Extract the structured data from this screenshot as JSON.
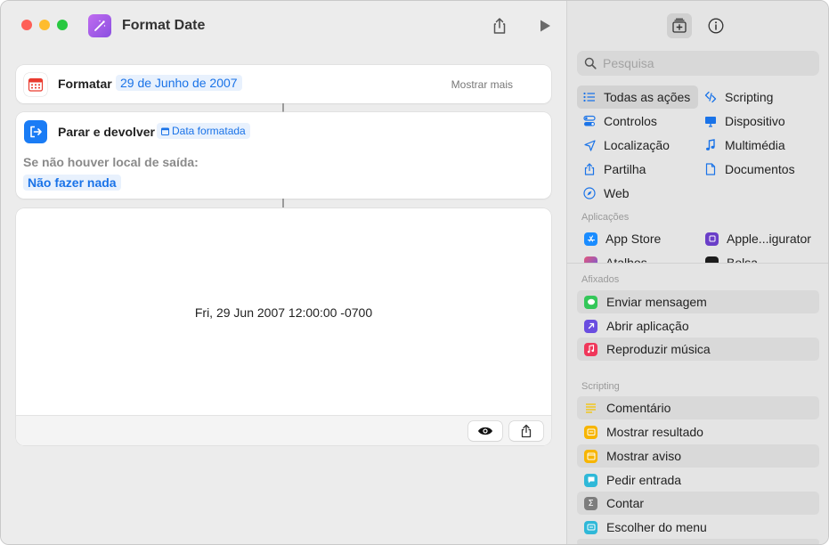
{
  "window": {
    "title": "Format Date"
  },
  "actions": {
    "format": {
      "label": "Formatar",
      "value": "29 de Junho de 2007",
      "more": "Mostrar mais"
    },
    "stop": {
      "label": "Parar e devolver",
      "token": "Data formatada",
      "fallback_label": "Se não houver local de saída:",
      "fallback_value": "Não fazer nada"
    }
  },
  "result": {
    "text": "Fri, 29 Jun 2007 12:00:00 -0700"
  },
  "sidebar": {
    "search_placeholder": "Pesquisa",
    "categories": [
      {
        "label": "Todas as ações",
        "icon": "list-icon"
      },
      {
        "label": "Scripting",
        "icon": "scripting-icon"
      },
      {
        "label": "Controlos",
        "icon": "toggle-icon"
      },
      {
        "label": "Dispositivo",
        "icon": "display-icon"
      },
      {
        "label": "Localização",
        "icon": "location-arrow-icon"
      },
      {
        "label": "Multimédia",
        "icon": "music-note-icon"
      },
      {
        "label": "Partilha",
        "icon": "share-icon"
      },
      {
        "label": "Documentos",
        "icon": "document-icon"
      },
      {
        "label": "Web",
        "icon": "compass-icon"
      }
    ],
    "apps_header": "Aplicações",
    "apps": [
      {
        "label": "App Store",
        "icon": "app-store-icon",
        "color": "#1a8cff"
      },
      {
        "label": "Apple...igurator",
        "icon": "apple-configurator-icon",
        "color": "#6a3ec8"
      },
      {
        "label": "Atalhos",
        "icon": "shortcuts-icon",
        "color": "#d9486b"
      },
      {
        "label": "Bolsa",
        "icon": "stocks-icon",
        "color": "#1c1c1c"
      }
    ],
    "pinned_header": "Afixados",
    "pinned": [
      {
        "label": "Enviar mensagem",
        "icon": "messages-icon",
        "color": "#34c759"
      },
      {
        "label": "Abrir aplicação",
        "icon": "open-app-icon",
        "color": "#6a4de0"
      },
      {
        "label": "Reproduzir música",
        "icon": "music-icon",
        "color": "#f0375a"
      }
    ],
    "scripting_header": "Scripting",
    "scripting": [
      {
        "label": "Comentário",
        "icon": "comment-icon",
        "color": "#f5d33a"
      },
      {
        "label": "Mostrar resultado",
        "icon": "show-result-icon",
        "color": "#f7b500"
      },
      {
        "label": "Mostrar aviso",
        "icon": "alert-icon",
        "color": "#f7b500"
      },
      {
        "label": "Pedir entrada",
        "icon": "ask-input-icon",
        "color": "#2fb8d8"
      },
      {
        "label": "Contar",
        "icon": "sigma-icon",
        "color": "#7d7d7d"
      },
      {
        "label": "Escolher do menu",
        "icon": "menu-icon",
        "color": "#2fb8d8"
      }
    ]
  }
}
